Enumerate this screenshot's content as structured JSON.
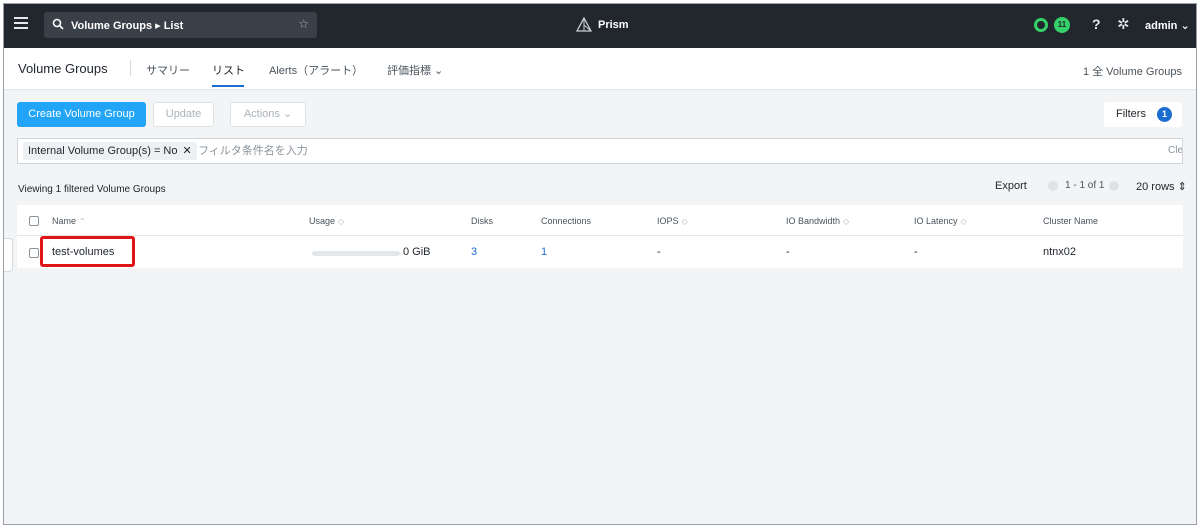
{
  "topbar": {
    "search_text": "Volume Groups ▸ List",
    "app_title": "Prism",
    "alert_count": "11",
    "help_label": "?",
    "user_name": "admin ⌄"
  },
  "nav": {
    "entity_title": "Volume Groups",
    "tabs": [
      {
        "label": "サマリー"
      },
      {
        "label": "リスト"
      },
      {
        "label": "Alerts（アラート）"
      },
      {
        "label": "評価指標 ⌄"
      }
    ],
    "active_tab": "リスト",
    "total_count": "1 全 Volume Groups"
  },
  "toolbar": {
    "create_label": "Create Volume Group",
    "update_label": "Update",
    "actions_label": "Actions ⌄",
    "filters_label": "Filters",
    "filters_count": "1"
  },
  "filter": {
    "chip_label": "Internal Volume Group(s) = No",
    "chip_remove": "✕",
    "placeholder": "フィルタ条件名を入力",
    "clear_label": "Clear"
  },
  "summary": {
    "viewing_text": "Viewing 1 filtered Volume Groups",
    "export_label": "Export",
    "page_range": "1 - 1 of 1",
    "rows_label": "20 rows ⇕"
  },
  "table": {
    "columns": [
      {
        "label": "Name",
        "sort": "⌃"
      },
      {
        "label": "Usage",
        "sort": "◇"
      },
      {
        "label": "Disks",
        "sort": ""
      },
      {
        "label": "Connections",
        "sort": ""
      },
      {
        "label": "IOPS",
        "sort": "◇"
      },
      {
        "label": "IO Bandwidth",
        "sort": "◇"
      },
      {
        "label": "IO Latency",
        "sort": "◇"
      },
      {
        "label": "Cluster Name",
        "sort": ""
      }
    ],
    "rows": [
      {
        "name": "test-volumes",
        "usage": "0 GiB",
        "usage_fraction": 0,
        "disks": "3",
        "connections": "1",
        "iops": "-",
        "io_bandwidth": "-",
        "io_latency": "-",
        "cluster_name": "ntnx02"
      }
    ]
  },
  "colors": {
    "topbar_bg": "#22272e",
    "primary_button": "#22a5f7",
    "link": "#1b6dd0",
    "status_green": "#36d068",
    "highlight_red": "#e01616"
  }
}
